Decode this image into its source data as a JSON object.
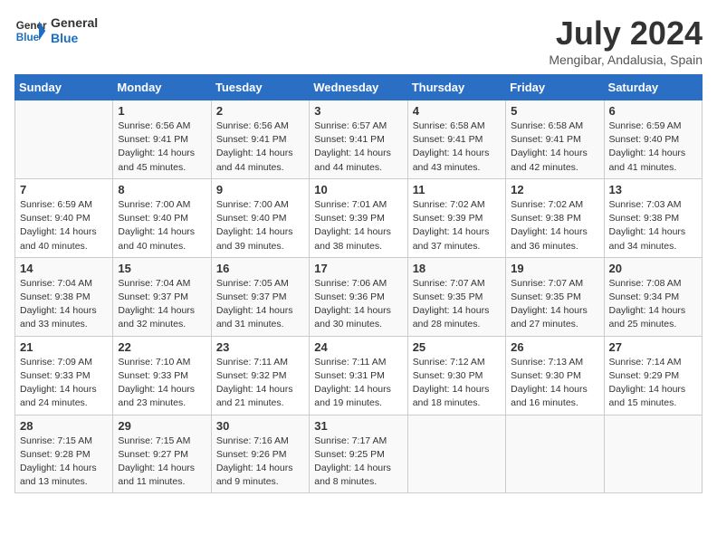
{
  "header": {
    "logo_line1": "General",
    "logo_line2": "Blue",
    "month_year": "July 2024",
    "location": "Mengibar, Andalusia, Spain"
  },
  "days_of_week": [
    "Sunday",
    "Monday",
    "Tuesday",
    "Wednesday",
    "Thursday",
    "Friday",
    "Saturday"
  ],
  "weeks": [
    [
      {
        "day": "",
        "info": ""
      },
      {
        "day": "1",
        "info": "Sunrise: 6:56 AM\nSunset: 9:41 PM\nDaylight: 14 hours\nand 45 minutes."
      },
      {
        "day": "2",
        "info": "Sunrise: 6:56 AM\nSunset: 9:41 PM\nDaylight: 14 hours\nand 44 minutes."
      },
      {
        "day": "3",
        "info": "Sunrise: 6:57 AM\nSunset: 9:41 PM\nDaylight: 14 hours\nand 44 minutes."
      },
      {
        "day": "4",
        "info": "Sunrise: 6:58 AM\nSunset: 9:41 PM\nDaylight: 14 hours\nand 43 minutes."
      },
      {
        "day": "5",
        "info": "Sunrise: 6:58 AM\nSunset: 9:41 PM\nDaylight: 14 hours\nand 42 minutes."
      },
      {
        "day": "6",
        "info": "Sunrise: 6:59 AM\nSunset: 9:40 PM\nDaylight: 14 hours\nand 41 minutes."
      }
    ],
    [
      {
        "day": "7",
        "info": "Sunrise: 6:59 AM\nSunset: 9:40 PM\nDaylight: 14 hours\nand 40 minutes."
      },
      {
        "day": "8",
        "info": "Sunrise: 7:00 AM\nSunset: 9:40 PM\nDaylight: 14 hours\nand 40 minutes."
      },
      {
        "day": "9",
        "info": "Sunrise: 7:00 AM\nSunset: 9:40 PM\nDaylight: 14 hours\nand 39 minutes."
      },
      {
        "day": "10",
        "info": "Sunrise: 7:01 AM\nSunset: 9:39 PM\nDaylight: 14 hours\nand 38 minutes."
      },
      {
        "day": "11",
        "info": "Sunrise: 7:02 AM\nSunset: 9:39 PM\nDaylight: 14 hours\nand 37 minutes."
      },
      {
        "day": "12",
        "info": "Sunrise: 7:02 AM\nSunset: 9:38 PM\nDaylight: 14 hours\nand 36 minutes."
      },
      {
        "day": "13",
        "info": "Sunrise: 7:03 AM\nSunset: 9:38 PM\nDaylight: 14 hours\nand 34 minutes."
      }
    ],
    [
      {
        "day": "14",
        "info": "Sunrise: 7:04 AM\nSunset: 9:38 PM\nDaylight: 14 hours\nand 33 minutes."
      },
      {
        "day": "15",
        "info": "Sunrise: 7:04 AM\nSunset: 9:37 PM\nDaylight: 14 hours\nand 32 minutes."
      },
      {
        "day": "16",
        "info": "Sunrise: 7:05 AM\nSunset: 9:37 PM\nDaylight: 14 hours\nand 31 minutes."
      },
      {
        "day": "17",
        "info": "Sunrise: 7:06 AM\nSunset: 9:36 PM\nDaylight: 14 hours\nand 30 minutes."
      },
      {
        "day": "18",
        "info": "Sunrise: 7:07 AM\nSunset: 9:35 PM\nDaylight: 14 hours\nand 28 minutes."
      },
      {
        "day": "19",
        "info": "Sunrise: 7:07 AM\nSunset: 9:35 PM\nDaylight: 14 hours\nand 27 minutes."
      },
      {
        "day": "20",
        "info": "Sunrise: 7:08 AM\nSunset: 9:34 PM\nDaylight: 14 hours\nand 25 minutes."
      }
    ],
    [
      {
        "day": "21",
        "info": "Sunrise: 7:09 AM\nSunset: 9:33 PM\nDaylight: 14 hours\nand 24 minutes."
      },
      {
        "day": "22",
        "info": "Sunrise: 7:10 AM\nSunset: 9:33 PM\nDaylight: 14 hours\nand 23 minutes."
      },
      {
        "day": "23",
        "info": "Sunrise: 7:11 AM\nSunset: 9:32 PM\nDaylight: 14 hours\nand 21 minutes."
      },
      {
        "day": "24",
        "info": "Sunrise: 7:11 AM\nSunset: 9:31 PM\nDaylight: 14 hours\nand 19 minutes."
      },
      {
        "day": "25",
        "info": "Sunrise: 7:12 AM\nSunset: 9:30 PM\nDaylight: 14 hours\nand 18 minutes."
      },
      {
        "day": "26",
        "info": "Sunrise: 7:13 AM\nSunset: 9:30 PM\nDaylight: 14 hours\nand 16 minutes."
      },
      {
        "day": "27",
        "info": "Sunrise: 7:14 AM\nSunset: 9:29 PM\nDaylight: 14 hours\nand 15 minutes."
      }
    ],
    [
      {
        "day": "28",
        "info": "Sunrise: 7:15 AM\nSunset: 9:28 PM\nDaylight: 14 hours\nand 13 minutes."
      },
      {
        "day": "29",
        "info": "Sunrise: 7:15 AM\nSunset: 9:27 PM\nDaylight: 14 hours\nand 11 minutes."
      },
      {
        "day": "30",
        "info": "Sunrise: 7:16 AM\nSunset: 9:26 PM\nDaylight: 14 hours\nand 9 minutes."
      },
      {
        "day": "31",
        "info": "Sunrise: 7:17 AM\nSunset: 9:25 PM\nDaylight: 14 hours\nand 8 minutes."
      },
      {
        "day": "",
        "info": ""
      },
      {
        "day": "",
        "info": ""
      },
      {
        "day": "",
        "info": ""
      }
    ]
  ]
}
